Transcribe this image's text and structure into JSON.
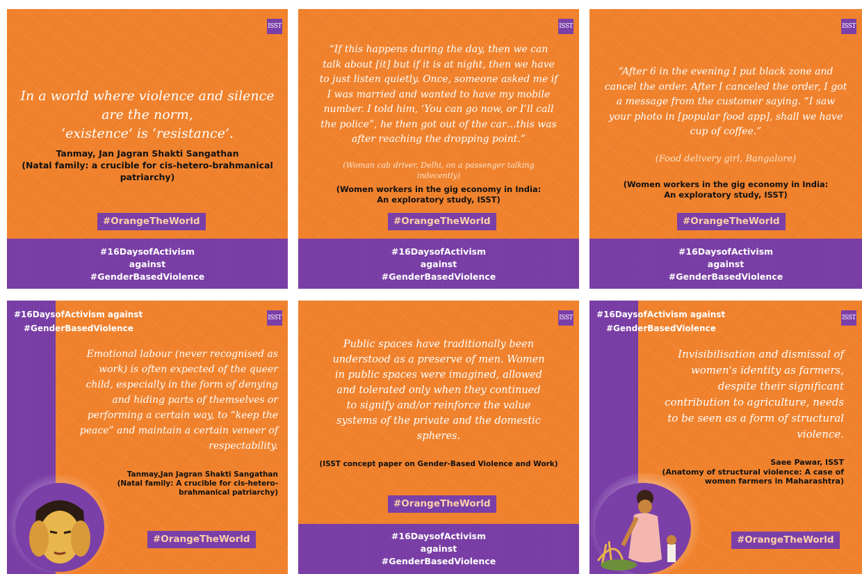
{
  "logo": "ISST",
  "tiles": [
    {
      "quote": [
        "In a world where violence and silence",
        "are the norm,",
        "‘existence’ is ‘resistance’."
      ],
      "credit": [
        "Tanmay, Jan Jagran Shakti Sangathan",
        "(Natal family: a crucible for cis-hetero-brahmanical",
        "patriarchy)"
      ],
      "tag": "#OrangeTheWorld",
      "band": [
        "#16DaysofActivism",
        "against",
        "#GenderBasedViolence"
      ]
    },
    {
      "quote": [
        "“If this happens during the day, then we can",
        "talk about [it] but if it is at night, then we have",
        "to just listen quietly. Once, someone asked me if",
        "I was married and wanted to have my mobile",
        "number. I told him, ‘You can go now, or I’ll call",
        "the police”, he then got out of the car…this was",
        "after reaching the dropping point.”"
      ],
      "sub": [
        "(Woman cab driver, Delhi, on a passenger talking",
        "indecently)"
      ],
      "credit": [
        "(Women workers in the gig economy in India:",
        "An exploratory study, ISST)"
      ],
      "tag": "#OrangeTheWorld",
      "band": [
        "#16DaysofActivism",
        "against",
        "#GenderBasedViolence"
      ]
    },
    {
      "quote": [
        "“After 6 in the evening I put black zone and",
        "cancel the order. After I canceled the order, I got",
        "a message from the customer saying. “I saw",
        "your photo in [popular food app], shall we have",
        "cup of coffee.”"
      ],
      "sub": [
        "(Food delivery girl, Bangalore)"
      ],
      "credit": [
        "(Women workers in the gig economy in India:",
        "An exploratory study, ISST)"
      ],
      "tag": "#OrangeTheWorld",
      "band": [
        "#16DaysofActivism",
        "against",
        "#GenderBasedViolence"
      ]
    },
    {
      "toptag": [
        "#16DaysofActivism against",
        "#GenderBasedViolence"
      ],
      "quote": [
        "Emotional labour (never recognised as",
        "work) is often expected of the queer",
        "child, especially in the form of denying",
        "and hiding parts of themselves or",
        "performing a certain way, to “keep the",
        "peace” and maintain a certain veneer of",
        "respectability."
      ],
      "credit": [
        "Tanmay,Jan Jagran Shakti Sangathan",
        "(Natal family: A crucible for cis-hetero-",
        "brahmanical patriarchy)"
      ],
      "tag": "#OrangeTheWorld"
    },
    {
      "quote": [
        "Public spaces have traditionally been",
        "understood as a preserve of men. Women",
        "in public spaces were imagined, allowed",
        "and tolerated only when they continued",
        "to signify and/or reinforce the value",
        "systems of the private and the domestic",
        "spheres."
      ],
      "credit": [
        "(ISST concept paper on Gender-Based Violence and Work)"
      ],
      "tag": "#OrangeTheWorld",
      "band": [
        "#16DaysofActivism",
        "against",
        "#GenderBasedViolence"
      ]
    },
    {
      "toptag": [
        "#16DaysofActivism against",
        "#GenderBasedViolence"
      ],
      "quote": [
        "Invisibilisation and dismissal of",
        "women's identity as farmers,",
        "despite their significant",
        "contribution to agriculture, needs",
        "to be seen as a form of structural",
        "violence."
      ],
      "credit": [
        "Saee Pawar, ISST",
        "(Anatomy of structural violence: A case of",
        "women farmers in Maharashtra)"
      ],
      "tag": "#OrangeTheWorld"
    }
  ]
}
